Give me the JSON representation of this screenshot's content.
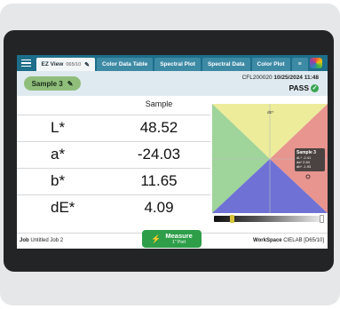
{
  "tabbar": {
    "menu_icon": "hamburger-icon",
    "tabs": [
      {
        "label": "EZ View",
        "sub": "065/10",
        "active": true
      },
      {
        "label": "Color Data Table"
      },
      {
        "label": "Spectral Plot"
      },
      {
        "label": "Spectral Data"
      },
      {
        "label": "Color Plot"
      }
    ],
    "pencil_icon": "pencil-icon",
    "settings_icon": "sliders-icon",
    "logo_icon": "color-wheel-logo"
  },
  "header": {
    "sample_label": "Sample 3",
    "device_id": "CFL200020",
    "datetime": "10/25/2024 11:48",
    "status": "PASS",
    "status_color": "#3aa655"
  },
  "table": {
    "column_header": "Sample",
    "rows": [
      {
        "label": "L*",
        "value": "48.52"
      },
      {
        "label": "a*",
        "value": "-24.03"
      },
      {
        "label": "b*",
        "value": "11.65"
      },
      {
        "label": "dE*",
        "value": "4.09"
      }
    ]
  },
  "plot": {
    "top_label": "dE*",
    "tooltip": {
      "title": "Sample 3",
      "lines": [
        "dL* -2.41",
        "da* 2.84",
        "db* -1.93"
      ]
    },
    "quadrant_colors": {
      "top": "#ecec9a",
      "left": "#9fd49a",
      "bottom": "#6f72d4",
      "right": "#e8948f"
    },
    "slider_level": 0.15
  },
  "footer": {
    "job_label": "Job",
    "job_value": "Untitled Job 2",
    "workspace_label": "WorkSpace",
    "workspace_value": "CIELAB [D65/10]",
    "measure_label": "Measure",
    "measure_sub": "1\" Port"
  }
}
